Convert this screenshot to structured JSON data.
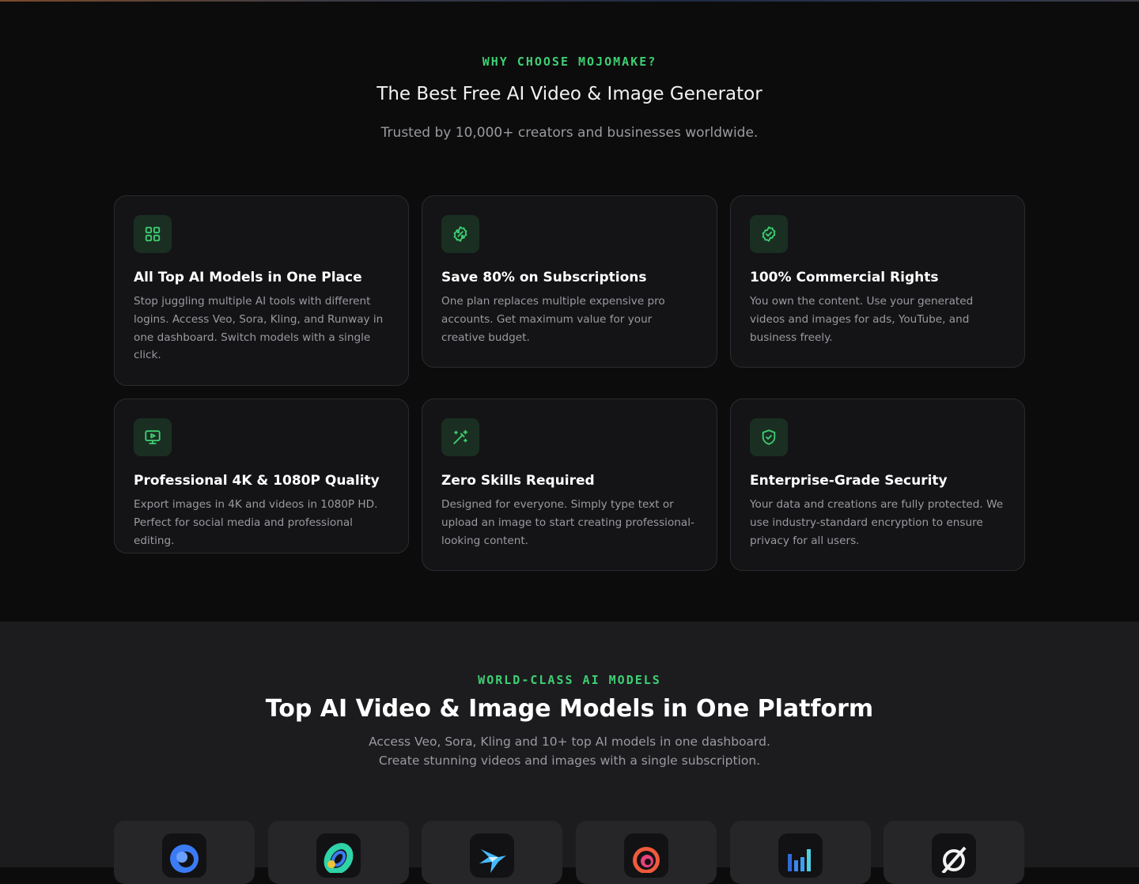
{
  "why_section": {
    "eyebrow": "WHY CHOOSE MOJOMAKE?",
    "title": "The Best Free AI Video & Image Generator",
    "subtitle": "Trusted by 10,000+ creators and businesses worldwide.",
    "features": [
      {
        "icon": "grid-icon",
        "title": "All Top AI Models in One Place",
        "description": "Stop juggling multiple AI tools with different logins. Access Veo, Sora, Kling, and Runway in one dashboard. Switch models with a single click."
      },
      {
        "icon": "percent-badge-icon",
        "title": "Save 80% on Subscriptions",
        "description": "One plan replaces multiple expensive pro accounts. Get maximum value for your creative budget."
      },
      {
        "icon": "check-badge-icon",
        "title": "100% Commercial Rights",
        "description": "You own the content. Use your generated videos and images for ads, YouTube, and business freely."
      },
      {
        "icon": "monitor-play-icon",
        "title": "Professional 4K & 1080P Quality",
        "description": "Export images in 4K and videos in 1080P HD. Perfect for social media and professional editing."
      },
      {
        "icon": "magic-wand-icon",
        "title": "Zero Skills Required",
        "description": "Designed for everyone. Simply type text or upload an image to start creating professional-looking content."
      },
      {
        "icon": "shield-check-icon",
        "title": "Enterprise-Grade Security",
        "description": "Your data and creations are fully protected. We use industry-standard encryption to ensure privacy for all users."
      }
    ],
    "accent_color": "#3ecf73"
  },
  "models_section": {
    "eyebrow": "WORLD-CLASS AI MODELS",
    "title": "Top AI Video & Image Models in One Platform",
    "subtitle_line1": "Access Veo, Sora, Kling and 10+ top AI models in one dashboard.",
    "subtitle_line2": "Create stunning videos and images with a single subscription.",
    "model_logos": [
      "swirl-blue-logo-icon",
      "ring-gradient-logo-icon",
      "star-burst-logo-icon",
      "spiral-orange-logo-icon",
      "bars-blue-logo-icon",
      "slashed-circle-logo-icon"
    ]
  }
}
